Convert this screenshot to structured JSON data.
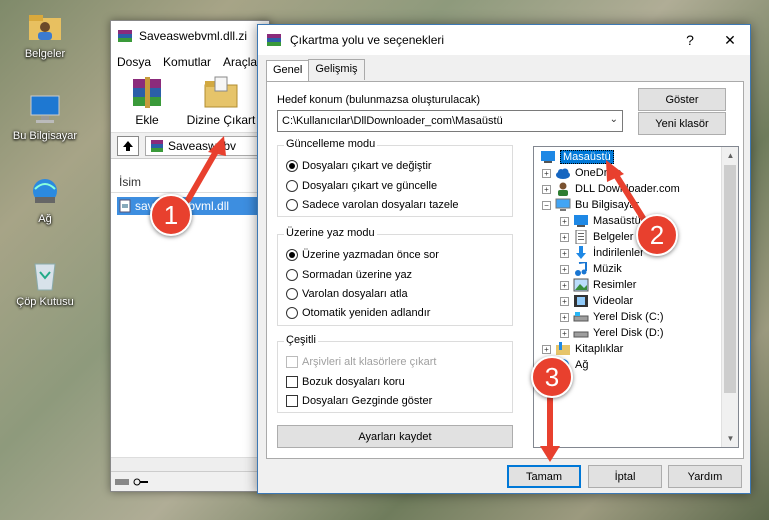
{
  "desktop": {
    "icons": [
      {
        "label": "Belgeler",
        "icon": "folder-user-icon"
      },
      {
        "label": "Bu Bilgisayar",
        "icon": "computer-icon"
      },
      {
        "label": "Ağ",
        "icon": "network-icon"
      },
      {
        "label": "Çöp Kutusu",
        "icon": "recycle-bin-icon"
      }
    ]
  },
  "back_window": {
    "title": "Saveaswebvml.dll.zi",
    "menu": [
      "Dosya",
      "Komutlar",
      "Araçla"
    ],
    "toolbar": {
      "add_label": "Ekle",
      "extract_label": "Dizine Çıkart"
    },
    "address": "Saveaswebv",
    "list_header": "İsim",
    "file_name": "saveaswebvml.dll"
  },
  "dialog": {
    "title": "Çıkartma yolu ve seçenekleri",
    "help_glyph": "?",
    "close_glyph": "✕",
    "tabs": [
      "Genel",
      "Gelişmiş"
    ],
    "dest_label": "Hedef konum (bulunmazsa oluşturulacak)",
    "dest_value": "C:\\Kullanıcılar\\DllDownloader_com\\Masaüstü",
    "show_button": "Göster",
    "new_folder_button": "Yeni klasör",
    "update_mode": {
      "title": "Güncelleme modu",
      "options": [
        "Dosyaları çıkart ve değiştir",
        "Dosyaları çıkart ve güncelle",
        "Sadece varolan dosyaları tazele"
      ],
      "selected": 0
    },
    "overwrite_mode": {
      "title": "Üzerine yaz modu",
      "options": [
        "Üzerine yazmadan önce sor",
        "Sormadan üzerine yaz",
        "Varolan dosyaları atla",
        "Otomatik yeniden adlandır"
      ],
      "selected": 0
    },
    "misc": {
      "title": "Çeşitli",
      "options": [
        "Arşivleri alt klasörlere çıkart",
        "Bozuk dosyaları koru",
        "Dosyaları Gezginde göster"
      ],
      "disabled": [
        true,
        false,
        false
      ],
      "checked": [
        false,
        false,
        false
      ]
    },
    "save_settings_button": "Ayarları kaydet",
    "tree": [
      {
        "label": "Masaüstü",
        "icon": "desktop-icon",
        "selected": true,
        "expander": ""
      },
      {
        "label": "OneDrive",
        "icon": "cloud-icon",
        "expander": "+"
      },
      {
        "label": "DLL Downloader.com",
        "icon": "user-icon",
        "expander": "+"
      },
      {
        "label": "Bu Bilgisayar",
        "icon": "computer-icon",
        "expander": "−"
      },
      {
        "label": "Masaüstü",
        "icon": "desktop-icon",
        "expander": "+"
      },
      {
        "label": "Belgeler",
        "icon": "document-icon",
        "expander": "+"
      },
      {
        "label": "İndirilenler",
        "icon": "download-icon",
        "expander": "+"
      },
      {
        "label": "Müzik",
        "icon": "music-icon",
        "expander": "+"
      },
      {
        "label": "Resimler",
        "icon": "pictures-icon",
        "expander": "+"
      },
      {
        "label": "Videolar",
        "icon": "video-icon",
        "expander": "+"
      },
      {
        "label": "Yerel Disk (C:)",
        "icon": "drive-icon",
        "expander": "+"
      },
      {
        "label": "Yerel Disk (D:)",
        "icon": "drive-icon",
        "expander": "+"
      },
      {
        "label": "Kitaplıklar",
        "icon": "library-icon",
        "expander": "+"
      },
      {
        "label": "Ağ",
        "icon": "network-icon",
        "expander": "+"
      }
    ],
    "ok_button": "Tamam",
    "cancel_button": "İptal",
    "help_button": "Yardım"
  },
  "annotations": [
    {
      "number": "1"
    },
    {
      "number": "2"
    },
    {
      "number": "3"
    }
  ],
  "colors": {
    "badge": "#e8402e",
    "selection": "#0078d7",
    "file_highlight": "#3d8ee0"
  }
}
